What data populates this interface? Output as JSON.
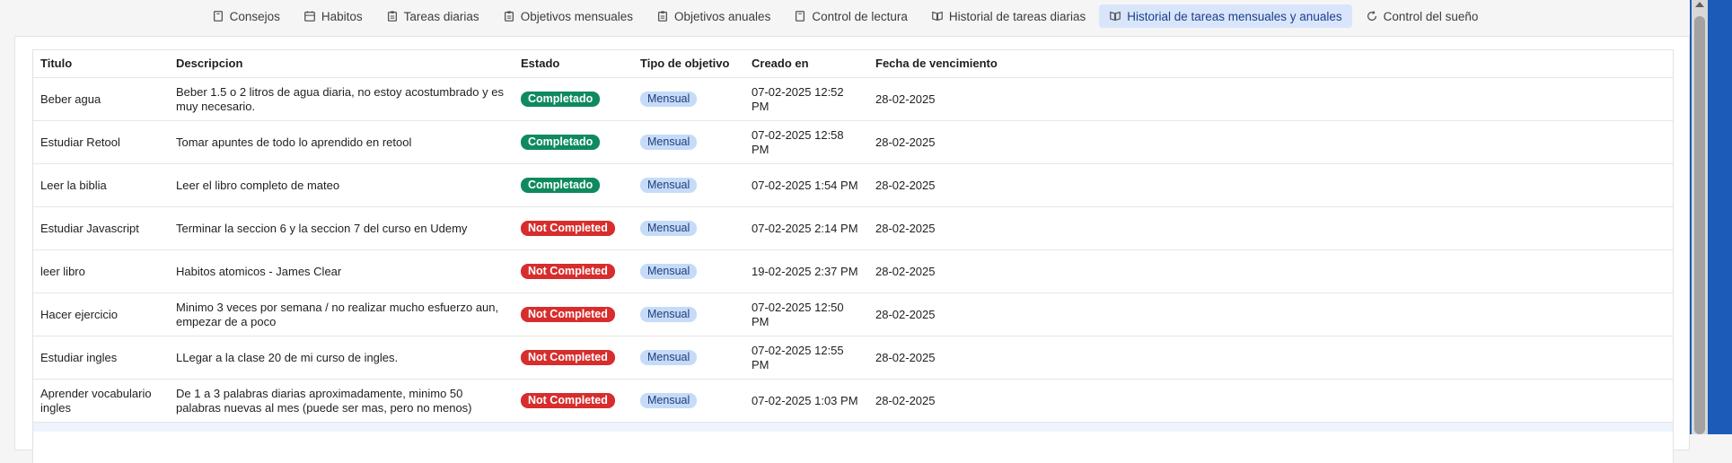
{
  "nav": {
    "items": [
      {
        "label": "Consejos",
        "icon": "book-icon"
      },
      {
        "label": "Habitos",
        "icon": "calendar-icon"
      },
      {
        "label": "Tareas diarias",
        "icon": "clipboard-icon"
      },
      {
        "label": "Objetivos mensuales",
        "icon": "clipboard-icon"
      },
      {
        "label": "Objetivos anuales",
        "icon": "clipboard-icon"
      },
      {
        "label": "Control de lectura",
        "icon": "book-icon"
      },
      {
        "label": "Historial de tareas diarias",
        "icon": "open-book-icon"
      },
      {
        "label": "Historial de tareas mensuales y anuales",
        "icon": "open-book-icon",
        "active": true
      },
      {
        "label": "Control del sueño",
        "icon": "refresh-icon"
      }
    ],
    "active_color": "#d9e5fb"
  },
  "table": {
    "headers": [
      "Titulo",
      "Descripcion",
      "Estado",
      "Tipo de objetivo",
      "Creado en",
      "Fecha de vencimiento"
    ],
    "rows": [
      {
        "titulo": "Beber agua",
        "descripcion": "Beber 1.5 o 2 litros de agua diaria, no estoy acostumbrado y es muy necesario.",
        "estado": "Completado",
        "tipo": "Mensual",
        "creado": "07-02-2025 12:52 PM",
        "vencimiento": "28-02-2025"
      },
      {
        "titulo": "Estudiar Retool",
        "descripcion": "Tomar apuntes de todo lo aprendido en retool",
        "estado": "Completado",
        "tipo": "Mensual",
        "creado": "07-02-2025 12:58 PM",
        "vencimiento": "28-02-2025"
      },
      {
        "titulo": "Leer la biblia",
        "descripcion": "Leer el libro completo de mateo",
        "estado": "Completado",
        "tipo": "Mensual",
        "creado": "07-02-2025 1:54 PM",
        "vencimiento": "28-02-2025"
      },
      {
        "titulo": "Estudiar Javascript",
        "descripcion": "Terminar la seccion 6 y la seccion 7 del curso en Udemy",
        "estado": "Not Completed",
        "tipo": "Mensual",
        "creado": "07-02-2025 2:14 PM",
        "vencimiento": "28-02-2025"
      },
      {
        "titulo": "leer libro",
        "descripcion": "Habitos atomicos - James Clear",
        "estado": "Not Completed",
        "tipo": "Mensual",
        "creado": "19-02-2025 2:37 PM",
        "vencimiento": "28-02-2025"
      },
      {
        "titulo": "Hacer ejercicio",
        "descripcion": "Minimo 3 veces por semana / no realizar mucho esfuerzo aun, empezar de a poco",
        "estado": "Not Completed",
        "tipo": "Mensual",
        "creado": "07-02-2025 12:50 PM",
        "vencimiento": "28-02-2025"
      },
      {
        "titulo": "Estudiar ingles",
        "descripcion": "LLegar a la clase 20 de mi curso de ingles.",
        "estado": "Not Completed",
        "tipo": "Mensual",
        "creado": "07-02-2025 12:55 PM",
        "vencimiento": "28-02-2025"
      },
      {
        "titulo": "Aprender vocabulario ingles",
        "descripcion": "De 1 a 3 palabras diarias aproximadamente, minimo 50 palabras nuevas al mes (puede ser mas, pero no menos)",
        "estado": "Not Completed",
        "tipo": "Mensual",
        "creado": "07-02-2025 1:03 PM",
        "vencimiento": "28-02-2025"
      }
    ]
  },
  "colors": {
    "completed": "#0f8a5f",
    "not_completed": "#d72d2d",
    "type_badge": "#c5dbf8"
  }
}
